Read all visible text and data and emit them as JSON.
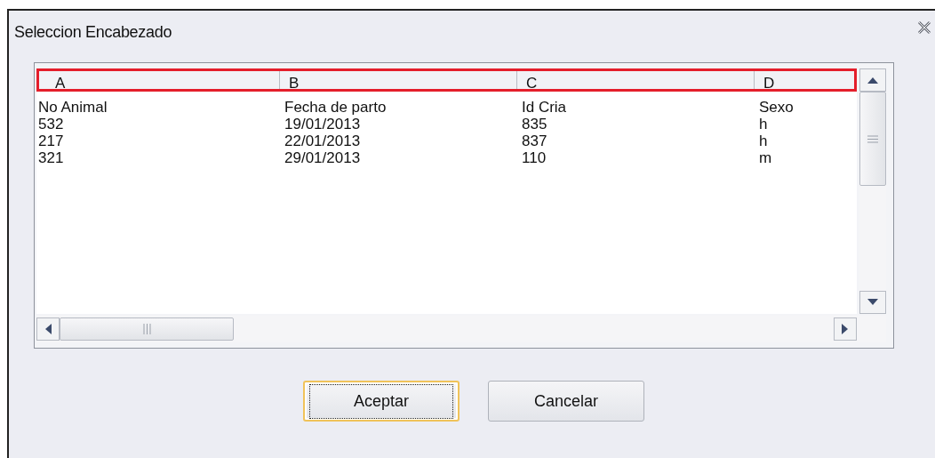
{
  "window": {
    "title": "Seleccion Encabezado"
  },
  "grid": {
    "header_highlighted": true,
    "columns": [
      "A",
      "B",
      "C",
      "D"
    ],
    "rows": [
      [
        "No Animal",
        "Fecha de parto",
        "Id Cria",
        "Sexo"
      ],
      [
        "532",
        "19/01/2013",
        "835",
        "h"
      ],
      [
        "217",
        "22/01/2013",
        "837",
        "h"
      ],
      [
        "321",
        "29/01/2013",
        "110",
        "m"
      ]
    ]
  },
  "buttons": [
    {
      "label": "Aceptar",
      "default": true
    },
    {
      "label": "Cancelar",
      "default": false
    }
  ]
}
